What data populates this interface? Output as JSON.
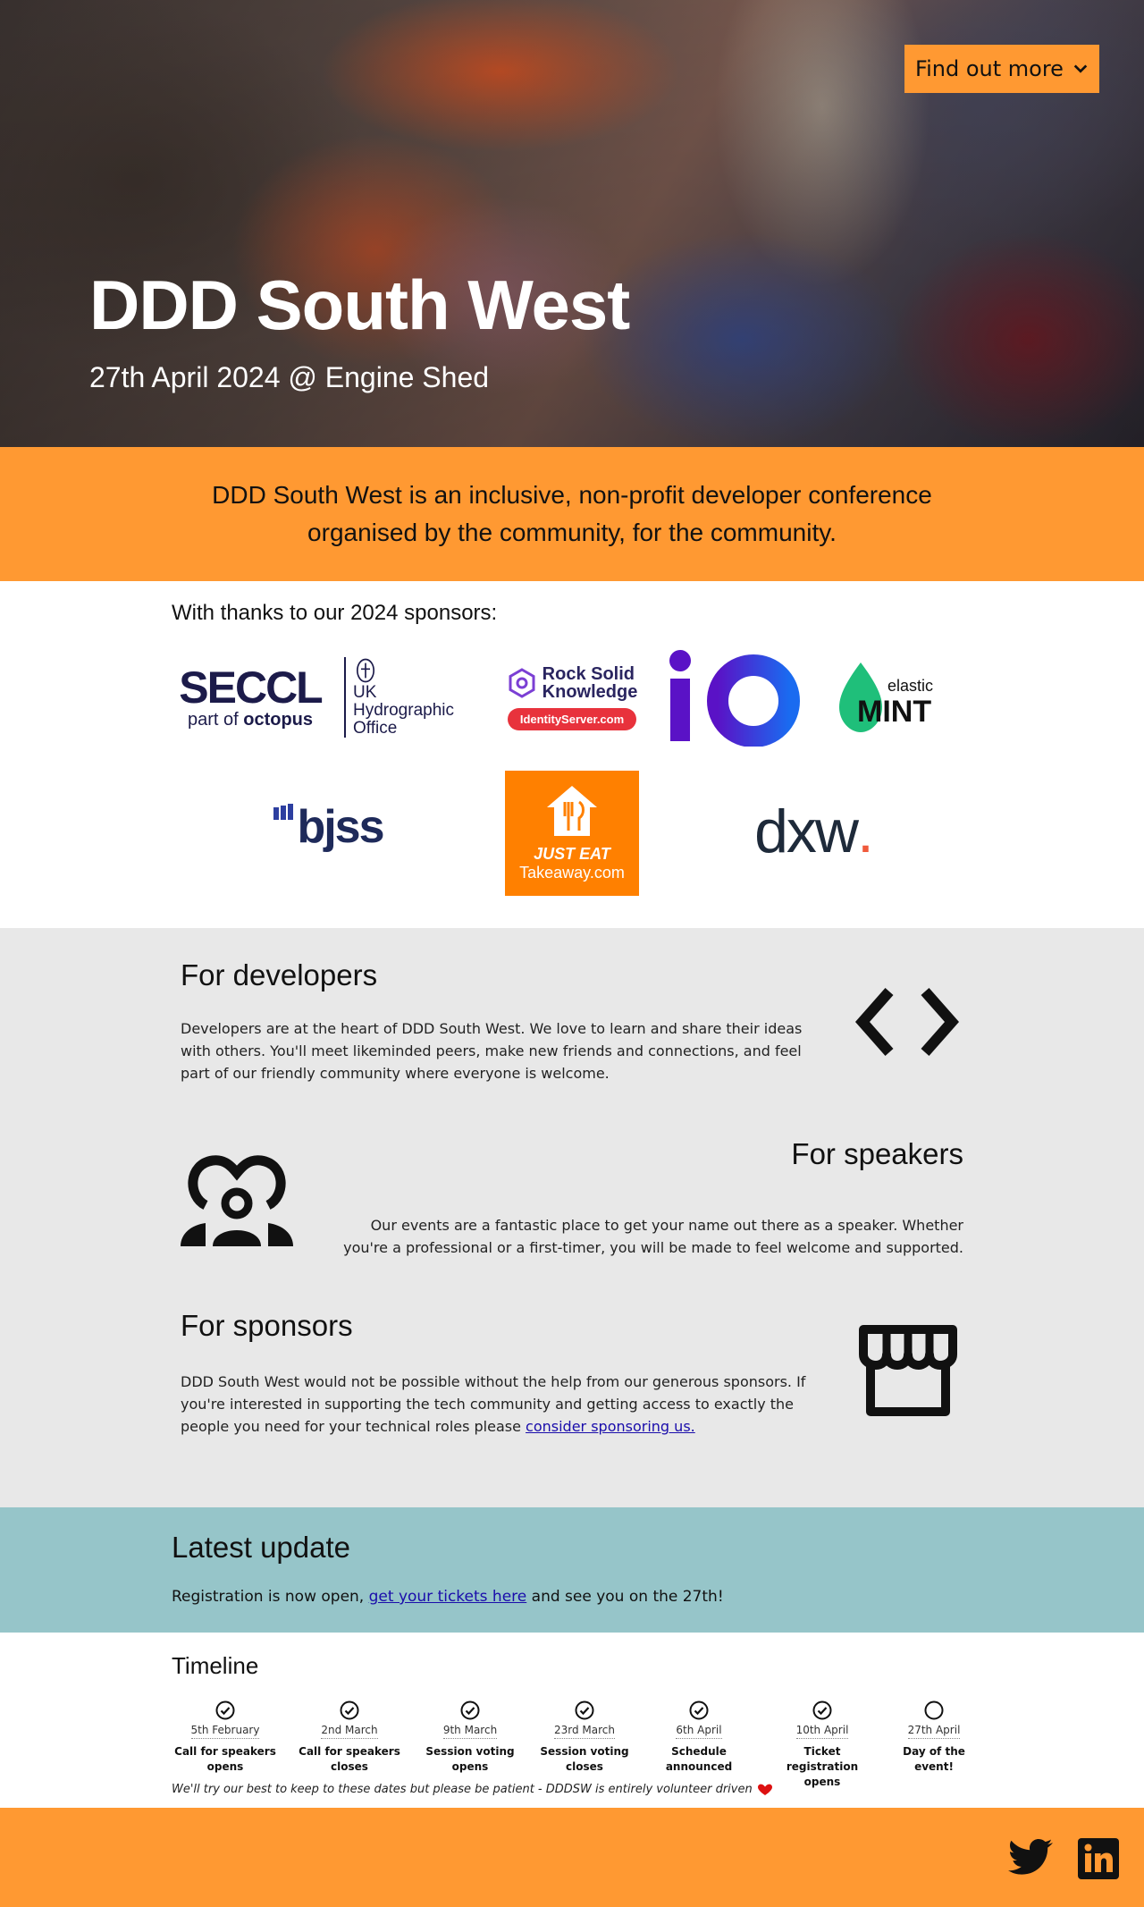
{
  "hero": {
    "button_label": "Find out more",
    "title": "DDD South West",
    "subtitle": "27th April 2024 @ Engine Shed"
  },
  "mission": {
    "text": "DDD South West is an inclusive, non-profit developer conference organised by the community, for the community."
  },
  "sponsors": {
    "heading": "With thanks to our 2024 sponsors:",
    "seccl": {
      "name": "SECCL",
      "tagline_prefix": "part of",
      "tagline_brand": "octopus"
    },
    "ukho": {
      "line1": "UK Hydrographic",
      "line2": "Office"
    },
    "rsk": {
      "line1": "Rock Solid",
      "line2": "Knowledge",
      "pill": "IdentityServer.com"
    },
    "io": {
      "text": "iO"
    },
    "mint": {
      "line1": "elastic",
      "line2": "MINT"
    },
    "bjss": {
      "text": "bjss"
    },
    "justeat": {
      "line1": "JUST EAT",
      "line2": "Takeaway.com"
    },
    "dxw": {
      "text": "dxw",
      "dot": "."
    }
  },
  "developers": {
    "title": "For developers",
    "text": "Developers are at the heart of DDD South West. We love to learn and share their ideas with others. You'll meet likeminded peers, make new friends and connections, and feel part of our friendly community where everyone is welcome."
  },
  "speakers": {
    "title": "For speakers",
    "text": "Our events are a fantastic place to get your name out there as a speaker. Whether you're a professional or a first-timer, you will be made to feel welcome and supported."
  },
  "sponsors_block": {
    "title": "For sponsors",
    "text": "DDD South West would not be possible without the help from our generous sponsors. If you're interested in supporting the tech community and getting access to exactly the people you need for your technical roles please",
    "link": "consider sponsoring us."
  },
  "latest": {
    "title": "Latest update",
    "text_before": "Registration is now open,",
    "link": "get your tickets here",
    "text_after": "and see you on the 27th!"
  },
  "timeline": {
    "title": "Timeline",
    "items": [
      {
        "date": "5th February",
        "line1": "Call for speakers",
        "line2": "opens",
        "done": true
      },
      {
        "date": "2nd March",
        "line1": "Call for speakers",
        "line2": "closes",
        "done": true
      },
      {
        "date": "9th March",
        "line1": "Session voting",
        "line2": "opens",
        "done": true
      },
      {
        "date": "23rd March",
        "line1": "Session voting",
        "line2": "closes",
        "done": true
      },
      {
        "date": "6th April",
        "line1": "Schedule",
        "line2": "announced",
        "done": true
      },
      {
        "date": "10th April",
        "line1": "Ticket registration",
        "line2": "opens",
        "done": true
      },
      {
        "date": "27th April",
        "line1": "Day of the",
        "line2": "event!",
        "done": false
      }
    ],
    "note": "We'll try our best to keep to these dates but please be patient - DDDSW is entirely volunteer driven"
  },
  "colors": {
    "brand_orange": "#ff9932",
    "section_grey": "#e8e8e8",
    "update_teal": "#96c5c9"
  },
  "icons": {
    "hero_button": "chevron-down-icon",
    "developers": "code-brackets-icon",
    "speakers": "audience-icon",
    "sponsors": "storefront-icon",
    "footer": [
      "twitter-icon",
      "linkedin-icon"
    ]
  }
}
